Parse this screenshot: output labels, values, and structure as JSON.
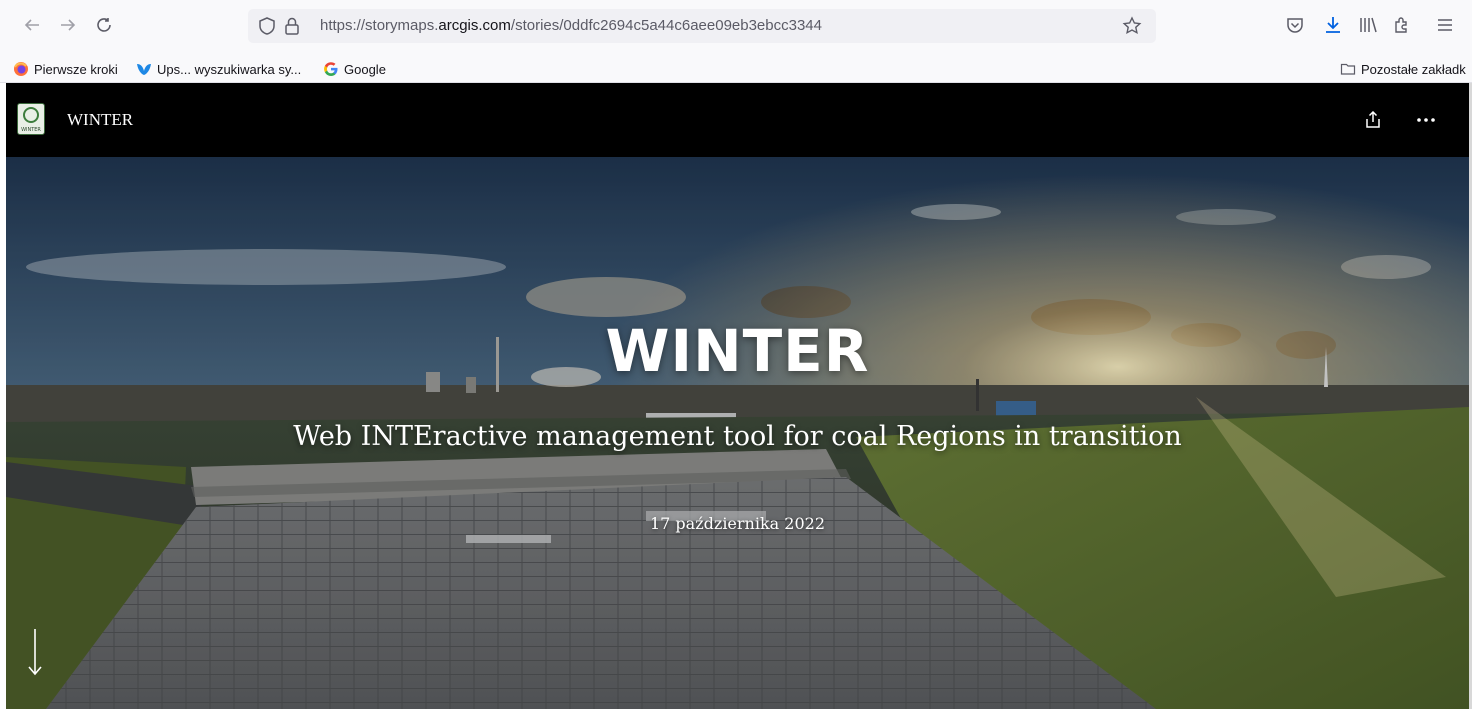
{
  "browser": {
    "url_prefix": "https://storymaps.",
    "url_domain": "arcgis.com",
    "url_path": "/stories/0ddfc2694c5a44c6aee09eb3ebcc3344",
    "icons": [
      "back-icon",
      "forward-icon",
      "reload-icon",
      "shield-icon",
      "lock-icon",
      "star-icon",
      "pocket-icon",
      "download-icon",
      "library-icon",
      "extensions-icon",
      "menu-icon"
    ]
  },
  "bookmarks": {
    "items": [
      {
        "label": "Pierwsze kroki",
        "icon": "firefox-icon"
      },
      {
        "label": "Ups... wyszukiwarka sy...",
        "icon": "bookmark-bird-icon"
      },
      {
        "label": "Google",
        "icon": "google-icon"
      }
    ],
    "other_label": "Pozostałe zakładk"
  },
  "story": {
    "site_title": "WINTER",
    "logo_text": "WINTER",
    "title": "WINTER",
    "subtitle": "Web INTEractive management tool for coal Regions in transition",
    "date": "17 października 2022"
  },
  "colors": {
    "header_bg": "#000000",
    "toolbar_bg": "#f9f9fb",
    "url_bg": "#f0f0f4",
    "download_accent": "#0061e0"
  }
}
